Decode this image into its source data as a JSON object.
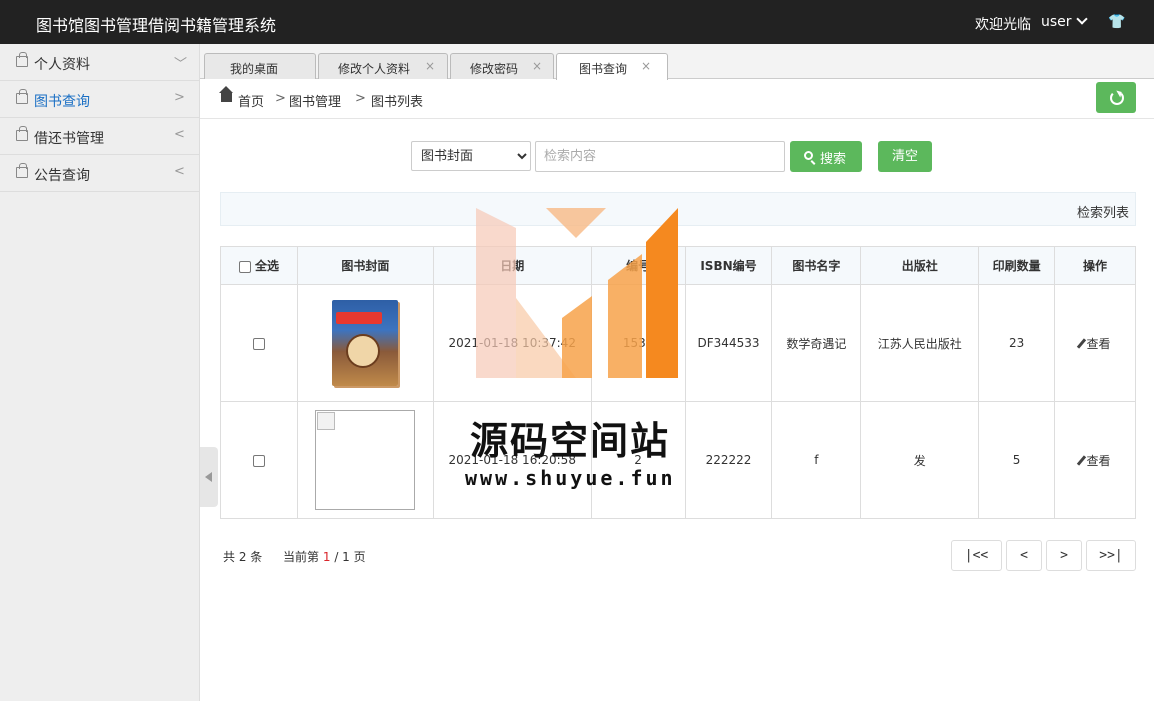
{
  "header": {
    "title": "图书馆图书管理借阅书籍管理系统",
    "welcome": "欢迎光临",
    "username": "user",
    "shirt_icon": "👕"
  },
  "sidebar": {
    "items": [
      {
        "label": "个人资料",
        "arrow": "﹀"
      },
      {
        "label": "图书查询",
        "arrow": ">"
      },
      {
        "label": "借还书管理",
        "arrow": "<"
      },
      {
        "label": "公告查询",
        "arrow": "<"
      }
    ]
  },
  "tabs": [
    {
      "label": "我的桌面",
      "close": ""
    },
    {
      "label": "修改个人资料",
      "close": "×"
    },
    {
      "label": "修改密码",
      "close": "×"
    },
    {
      "label": "图书查询",
      "close": "×"
    }
  ],
  "breadcrumb": {
    "home": "首页",
    "level1": "图书管理",
    "level2": "图书列表",
    "sep": ">"
  },
  "search": {
    "selected_field": "图书封面",
    "placeholder": "检索内容",
    "search_label": "搜索",
    "clear_label": "清空",
    "list_title": "检索列表"
  },
  "table": {
    "select_all": "全选",
    "headers": [
      "图书封面",
      "日期",
      "编号",
      "ISBN编号",
      "图书名字",
      "出版社",
      "印刷数量",
      "操作"
    ],
    "rows": [
      {
        "date": "2021-01-18 10:37:42",
        "code": "1532",
        "isbn": "DF344533",
        "name": "数学奇遇记",
        "publisher": "江苏人民出版社",
        "qty": "23",
        "action": "查看"
      },
      {
        "date": "2021-01-18 16:20:58",
        "code": "2",
        "isbn": "222222",
        "name": "f",
        "publisher": "发",
        "qty": "5",
        "action": "查看"
      }
    ]
  },
  "pager": {
    "total": "共 2 条",
    "current_prefix": "当前第",
    "current": "1",
    "total_pages": "/ 1 页",
    "first": "|<<",
    "prev": "<",
    "next": ">",
    "last": ">>|"
  },
  "watermark": {
    "name": "源码空间站",
    "url": "www.shuyue.fun"
  },
  "colors": {
    "header_bg": "#222222",
    "accent_green": "#5cb85c",
    "link_blue": "#1a6fc4",
    "page_number_red": "#d9262c",
    "watermark_orange": "#f5891f"
  }
}
